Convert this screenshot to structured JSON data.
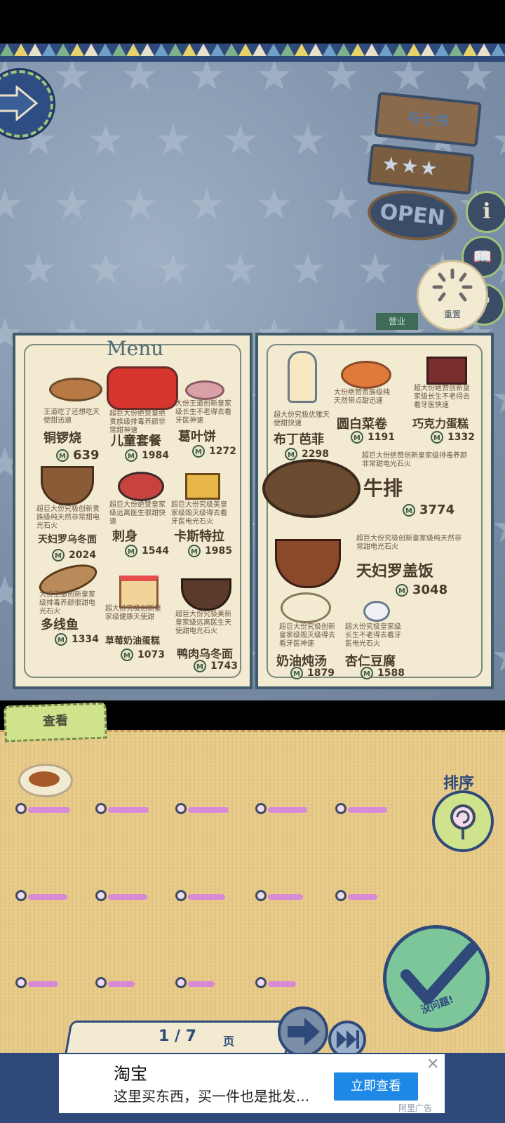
{
  "shop": {
    "name": "与七书",
    "open_label": "OPEN",
    "reset_label": "重置",
    "hours_label": "营业"
  },
  "menu_title": "Menu",
  "left_page": [
    {
      "name": "铜锣烧",
      "desc": "王道吃了还想吃天使甜迅速",
      "price": "639"
    },
    {
      "name": "儿童套餐",
      "desc": "超巨大份绝赞皇绝贵族级排毒养颜非常甜神速",
      "price": "1984"
    },
    {
      "name": "葛叶饼",
      "desc": "大份王道创新皇家级长生不老得去看牙医神速",
      "price": "1272"
    },
    {
      "name": "天妇罗乌冬面",
      "desc": "超巨大份究极创新贵族级纯天然非常甜电光石火",
      "price": "2024"
    },
    {
      "name": "刺身",
      "desc": "超巨大份绝赞皇家级远离医生很甜快速",
      "price": "1544"
    },
    {
      "name": "卡斯特拉",
      "desc": "超巨大份究极美皇家级毁灭级得去看牙医电光石火",
      "price": "1985"
    },
    {
      "name": "多线鱼",
      "desc": "大份王道创新皇家级排毒养颜很甜电光石火",
      "price": "1334"
    },
    {
      "name": "草莓奶油蛋糕",
      "desc": "超大份究极创新皇家级健康天使甜",
      "price": "1073"
    },
    {
      "name": "鸭肉乌冬面",
      "desc": "超巨大份究极美新皇家级远离医生天使甜电光石火",
      "price": "1743"
    }
  ],
  "right_page": [
    {
      "name": "布丁芭菲",
      "desc": "超大份究极优雅天使甜快速",
      "price": "2298"
    },
    {
      "name": "圆白菜卷",
      "desc": "大份绝赞贵族级纯天然带点甜迅速",
      "price": "1191"
    },
    {
      "name": "巧克力蛋糕",
      "desc": "超大份绝赞创新皇家级长生不老得去看牙医快速",
      "price": "1332"
    },
    {
      "name": "牛排",
      "desc": "超巨大份绝赞创新皇家级排毒养颜非常甜电光石火",
      "price": "3774"
    },
    {
      "name": "天妇罗盖饭",
      "desc": "超巨大份究极创新皇家级纯天然非常甜电光石火",
      "price": "3048"
    },
    {
      "name": "奶油炖汤",
      "desc": "超巨大份究极创新皇家级毁灭级得去看牙医神速",
      "price": "1879"
    },
    {
      "name": "杏仁豆腐",
      "desc": "超大份究极皇家级长生不老得去看牙医电光石火",
      "price": "1588"
    }
  ],
  "coin_symbol": "M",
  "view_tab": "查看",
  "sort_label": "排序",
  "confirm_label": "没问题!",
  "pager": {
    "current": "1 / 7",
    "unit": "页"
  },
  "slot_levels": [
    0.75,
    0.72,
    0.72,
    0.7,
    0.7,
    0.7,
    0.7,
    0.66,
    0.62,
    0.52,
    0.54,
    0.48,
    0.48,
    0.5
  ],
  "ad": {
    "title": "淘宝",
    "text": "这里买东西，买一件也是批发...",
    "button": "立即查看",
    "close": "✕",
    "note": "阿里广告"
  },
  "colors": {
    "frame": "#3e5d6a",
    "paper": "#f3ead2",
    "accent": "#2f4a7a",
    "tray": "#e8ca86",
    "meter": "#d78ad7"
  }
}
